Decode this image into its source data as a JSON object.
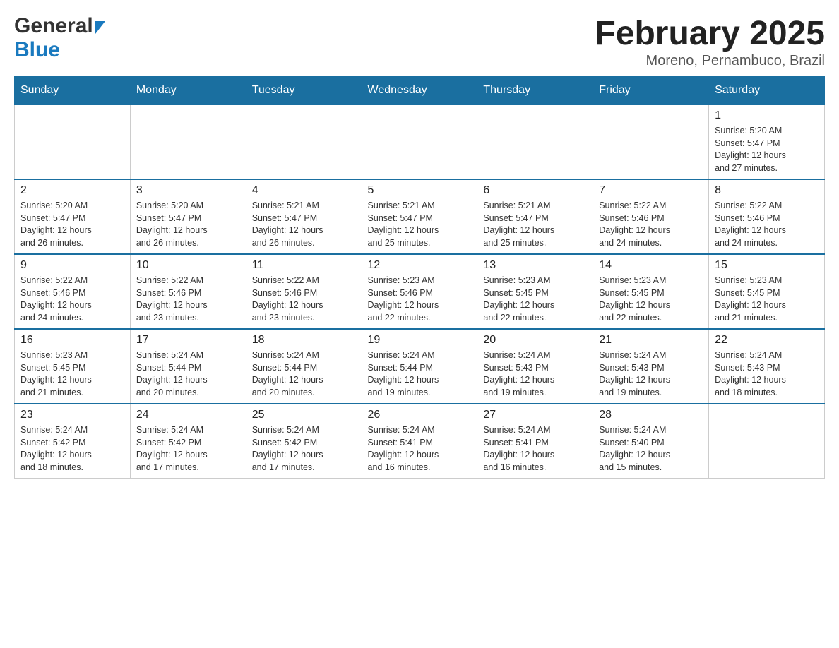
{
  "header": {
    "logo_general": "General",
    "logo_blue": "Blue",
    "month_title": "February 2025",
    "location": "Moreno, Pernambuco, Brazil"
  },
  "days_of_week": [
    "Sunday",
    "Monday",
    "Tuesday",
    "Wednesday",
    "Thursday",
    "Friday",
    "Saturday"
  ],
  "weeks": [
    [
      {
        "day": "",
        "info": ""
      },
      {
        "day": "",
        "info": ""
      },
      {
        "day": "",
        "info": ""
      },
      {
        "day": "",
        "info": ""
      },
      {
        "day": "",
        "info": ""
      },
      {
        "day": "",
        "info": ""
      },
      {
        "day": "1",
        "info": "Sunrise: 5:20 AM\nSunset: 5:47 PM\nDaylight: 12 hours\nand 27 minutes."
      }
    ],
    [
      {
        "day": "2",
        "info": "Sunrise: 5:20 AM\nSunset: 5:47 PM\nDaylight: 12 hours\nand 26 minutes."
      },
      {
        "day": "3",
        "info": "Sunrise: 5:20 AM\nSunset: 5:47 PM\nDaylight: 12 hours\nand 26 minutes."
      },
      {
        "day": "4",
        "info": "Sunrise: 5:21 AM\nSunset: 5:47 PM\nDaylight: 12 hours\nand 26 minutes."
      },
      {
        "day": "5",
        "info": "Sunrise: 5:21 AM\nSunset: 5:47 PM\nDaylight: 12 hours\nand 25 minutes."
      },
      {
        "day": "6",
        "info": "Sunrise: 5:21 AM\nSunset: 5:47 PM\nDaylight: 12 hours\nand 25 minutes."
      },
      {
        "day": "7",
        "info": "Sunrise: 5:22 AM\nSunset: 5:46 PM\nDaylight: 12 hours\nand 24 minutes."
      },
      {
        "day": "8",
        "info": "Sunrise: 5:22 AM\nSunset: 5:46 PM\nDaylight: 12 hours\nand 24 minutes."
      }
    ],
    [
      {
        "day": "9",
        "info": "Sunrise: 5:22 AM\nSunset: 5:46 PM\nDaylight: 12 hours\nand 24 minutes."
      },
      {
        "day": "10",
        "info": "Sunrise: 5:22 AM\nSunset: 5:46 PM\nDaylight: 12 hours\nand 23 minutes."
      },
      {
        "day": "11",
        "info": "Sunrise: 5:22 AM\nSunset: 5:46 PM\nDaylight: 12 hours\nand 23 minutes."
      },
      {
        "day": "12",
        "info": "Sunrise: 5:23 AM\nSunset: 5:46 PM\nDaylight: 12 hours\nand 22 minutes."
      },
      {
        "day": "13",
        "info": "Sunrise: 5:23 AM\nSunset: 5:45 PM\nDaylight: 12 hours\nand 22 minutes."
      },
      {
        "day": "14",
        "info": "Sunrise: 5:23 AM\nSunset: 5:45 PM\nDaylight: 12 hours\nand 22 minutes."
      },
      {
        "day": "15",
        "info": "Sunrise: 5:23 AM\nSunset: 5:45 PM\nDaylight: 12 hours\nand 21 minutes."
      }
    ],
    [
      {
        "day": "16",
        "info": "Sunrise: 5:23 AM\nSunset: 5:45 PM\nDaylight: 12 hours\nand 21 minutes."
      },
      {
        "day": "17",
        "info": "Sunrise: 5:24 AM\nSunset: 5:44 PM\nDaylight: 12 hours\nand 20 minutes."
      },
      {
        "day": "18",
        "info": "Sunrise: 5:24 AM\nSunset: 5:44 PM\nDaylight: 12 hours\nand 20 minutes."
      },
      {
        "day": "19",
        "info": "Sunrise: 5:24 AM\nSunset: 5:44 PM\nDaylight: 12 hours\nand 19 minutes."
      },
      {
        "day": "20",
        "info": "Sunrise: 5:24 AM\nSunset: 5:43 PM\nDaylight: 12 hours\nand 19 minutes."
      },
      {
        "day": "21",
        "info": "Sunrise: 5:24 AM\nSunset: 5:43 PM\nDaylight: 12 hours\nand 19 minutes."
      },
      {
        "day": "22",
        "info": "Sunrise: 5:24 AM\nSunset: 5:43 PM\nDaylight: 12 hours\nand 18 minutes."
      }
    ],
    [
      {
        "day": "23",
        "info": "Sunrise: 5:24 AM\nSunset: 5:42 PM\nDaylight: 12 hours\nand 18 minutes."
      },
      {
        "day": "24",
        "info": "Sunrise: 5:24 AM\nSunset: 5:42 PM\nDaylight: 12 hours\nand 17 minutes."
      },
      {
        "day": "25",
        "info": "Sunrise: 5:24 AM\nSunset: 5:42 PM\nDaylight: 12 hours\nand 17 minutes."
      },
      {
        "day": "26",
        "info": "Sunrise: 5:24 AM\nSunset: 5:41 PM\nDaylight: 12 hours\nand 16 minutes."
      },
      {
        "day": "27",
        "info": "Sunrise: 5:24 AM\nSunset: 5:41 PM\nDaylight: 12 hours\nand 16 minutes."
      },
      {
        "day": "28",
        "info": "Sunrise: 5:24 AM\nSunset: 5:40 PM\nDaylight: 12 hours\nand 15 minutes."
      },
      {
        "day": "",
        "info": ""
      }
    ]
  ]
}
